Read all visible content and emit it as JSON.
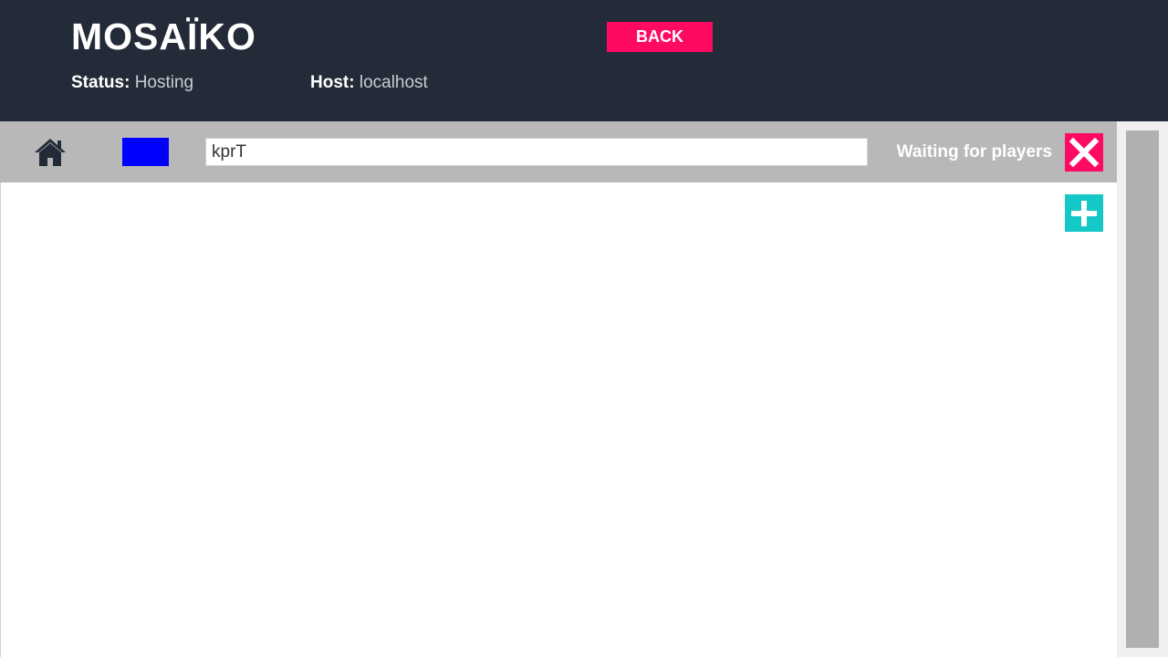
{
  "app": {
    "title": "MOSAÏKO"
  },
  "header": {
    "back_label": "BACK",
    "status_label": "Status:",
    "status_value": "Hosting",
    "host_label": "Host:",
    "host_value": "localhost"
  },
  "toolbar": {
    "home_icon": "home-icon",
    "swatch_color": "#0000ff",
    "room_input_value": "kprT",
    "waiting_text": "Waiting for players",
    "close_icon": "close-icon",
    "add_icon": "plus-icon"
  },
  "colors": {
    "header_bg": "#222b37",
    "accent_pink": "#ff0a63",
    "accent_teal": "#14c8c8",
    "toolbar_bg": "#b8b8b8"
  }
}
